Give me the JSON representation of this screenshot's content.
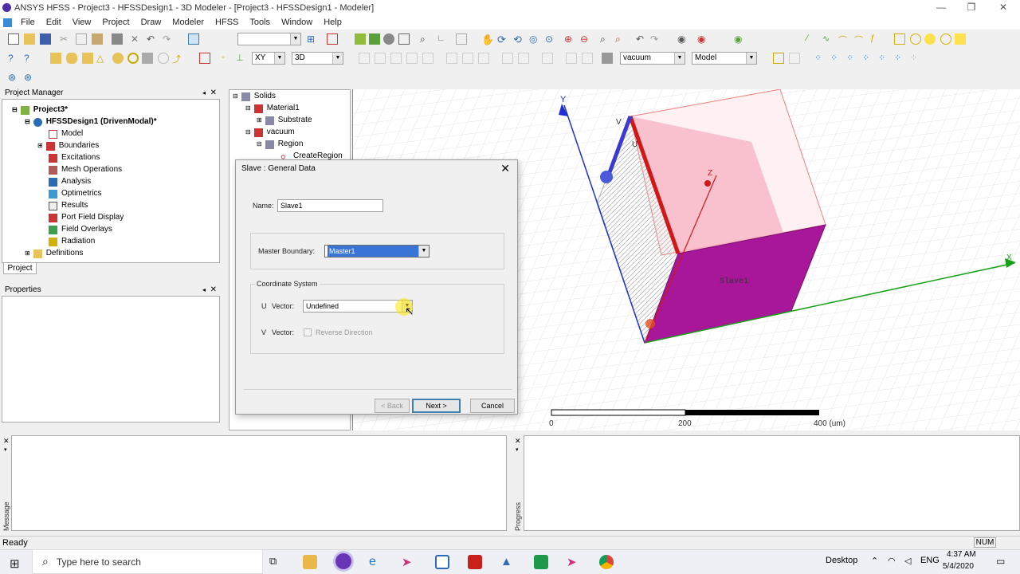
{
  "window": {
    "title": "ANSYS HFSS - Project3 - HFSSDesign1 - 3D Modeler - [Project3 - HFSSDesign1 - Modeler]"
  },
  "menu": [
    "File",
    "Edit",
    "View",
    "Project",
    "Draw",
    "Modeler",
    "HFSS",
    "Tools",
    "Window",
    "Help"
  ],
  "toolbar": {
    "plane": "XY",
    "mode": "3D",
    "material": "vacuum",
    "model": "Model"
  },
  "project_manager": {
    "title": "Project Manager",
    "items": [
      {
        "label": "Project3*"
      },
      {
        "label": "HFSSDesign1 (DrivenModal)*"
      },
      {
        "label": "Model"
      },
      {
        "label": "Boundaries"
      },
      {
        "label": "Excitations"
      },
      {
        "label": "Mesh Operations"
      },
      {
        "label": "Analysis"
      },
      {
        "label": "Optimetrics"
      },
      {
        "label": "Results"
      },
      {
        "label": "Port Field Display"
      },
      {
        "label": "Field Overlays"
      },
      {
        "label": "Radiation"
      },
      {
        "label": "Definitions"
      }
    ],
    "tab": "Project"
  },
  "properties": {
    "title": "Properties"
  },
  "history_tree": {
    "items": [
      {
        "label": "Solids"
      },
      {
        "label": "Material1"
      },
      {
        "label": "Substrate"
      },
      {
        "label": "vacuum"
      },
      {
        "label": "Region"
      },
      {
        "label": "CreateRegion"
      }
    ]
  },
  "viewport": {
    "axis_y": "Y",
    "axis_z": "Z",
    "axis_x": "X",
    "axis_v": "V",
    "axis_u": "U",
    "object_label": "Slave1",
    "scale_labels": [
      "0",
      "200",
      "400 (um)"
    ]
  },
  "dialog": {
    "title": "Slave : General Data",
    "name_label": "Name:",
    "name_value": "Slave1",
    "master_label": "Master Boundary:",
    "master_value": "Master1",
    "coord_group": "Coordinate System",
    "u_label": "U",
    "u_vector_label": "Vector:",
    "u_value": "Undefined",
    "v_label": "V",
    "v_vector_label": "Vector:",
    "reverse_label": "Reverse Direction",
    "back": "< Back",
    "next": "Next >",
    "cancel": "Cancel"
  },
  "bottom": {
    "message_manager": "Message Manager",
    "progress": "Progress"
  },
  "status": {
    "text": "Ready",
    "num": "NUM"
  },
  "taskbar": {
    "search_placeholder": "Type here to search",
    "desktop": "Desktop",
    "lang": "ENG",
    "time": "4:37 AM",
    "date": "5/4/2020"
  }
}
